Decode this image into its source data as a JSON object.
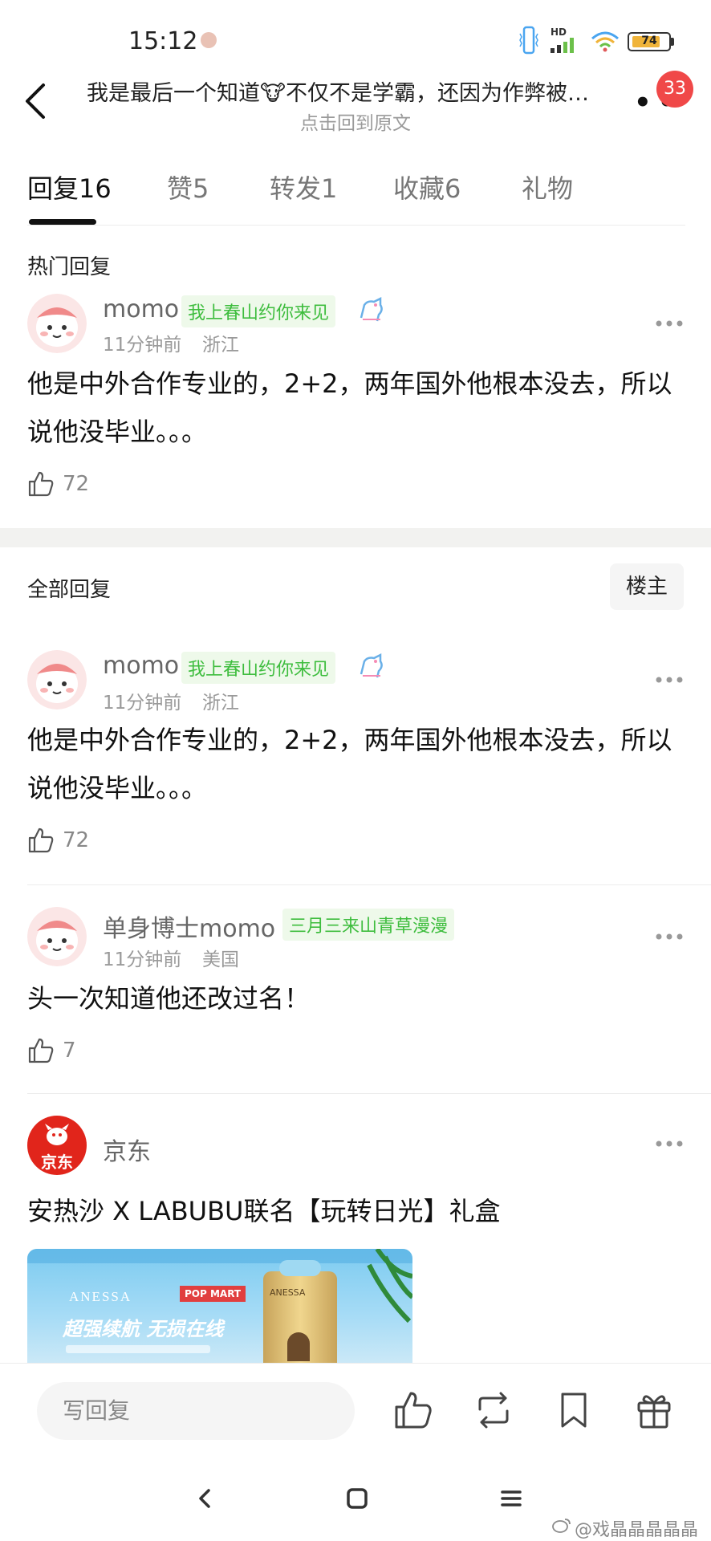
{
  "status_bar": {
    "time": "15:12",
    "network_label": "HD",
    "battery": "74"
  },
  "header": {
    "title": "我是最后一个知道🐮不仅不是学霸，还因为作弊被…",
    "subtitle": "点击回到原文",
    "notification_count": "33"
  },
  "tabs": [
    {
      "label": "回复16"
    },
    {
      "label": "赞5"
    },
    {
      "label": "转发1"
    },
    {
      "label": "收藏6"
    },
    {
      "label": "礼物"
    }
  ],
  "hot_section": {
    "label": "热门回复",
    "comment": {
      "username": "momo",
      "flair": "我上春山约你来见",
      "time": "11分钟前",
      "location": "浙江",
      "text": "他是中外合作专业的，2+2，两年国外他根本没去，所以说他没毕业。。。",
      "likes": "72"
    }
  },
  "all_section": {
    "label": "全部回复",
    "owner_button": "楼主",
    "comments": [
      {
        "username": "momo",
        "flair": "我上春山约你来见",
        "time": "11分钟前",
        "location": "浙江",
        "text": "他是中外合作专业的，2+2，两年国外他根本没去，所以说他没毕业。。。",
        "likes": "72"
      },
      {
        "username": "单身博士momo",
        "flair": "三月三来山青草漫漫",
        "time": "11分钟前",
        "location": "美国",
        "text": "头一次知道他还改过名！",
        "likes": "7"
      }
    ]
  },
  "ad": {
    "brand": "京东",
    "brand_logo_text": "京东",
    "title": "安热沙 X LABUBU联名【玩转日光】礼盒",
    "banner": {
      "brand_mark": "ANESSA",
      "partner_mark": "POP MART",
      "headline": "超强续航 无损在线",
      "product_mark": "ANESSA"
    }
  },
  "bottom_bar": {
    "reply_placeholder": "写回复"
  },
  "watermark": "@戏晶晶晶晶晶",
  "colors": {
    "accent_green": "#3ebd3e",
    "badge_red": "#f04848",
    "ad_red": "#e1251b"
  }
}
